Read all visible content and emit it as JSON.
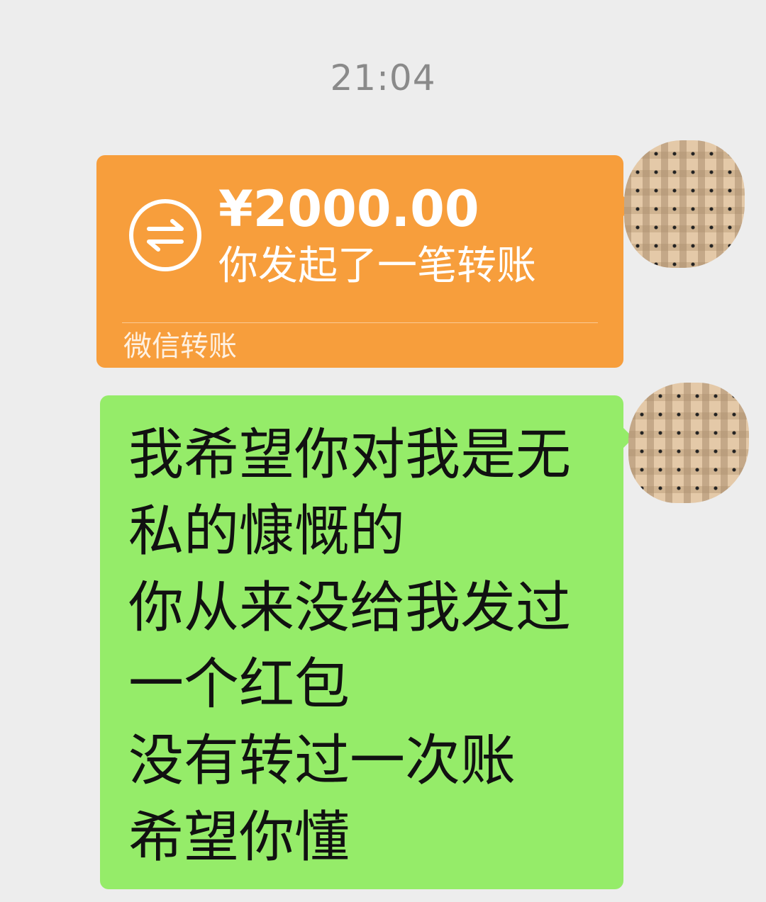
{
  "timestamp": "21:04",
  "messages": [
    {
      "type": "transfer",
      "amount": "¥2000.00",
      "status": "你发起了一笔转账",
      "footer": "微信转账",
      "icon": "transfer-arrows-icon",
      "color": "#f79e3c"
    },
    {
      "type": "text",
      "color": "#95ec69",
      "lines": [
        "我希望你对我是无",
        "私的慷慨的",
        "你从来没给我发过",
        "一个红包",
        "没有转过一次账",
        "希望你懂"
      ]
    }
  ]
}
